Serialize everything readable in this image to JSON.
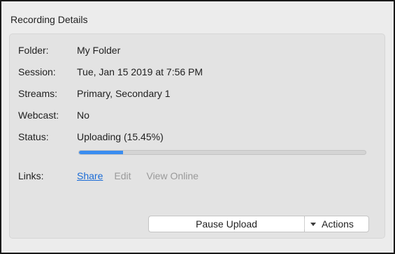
{
  "group": {
    "title": "Recording Details"
  },
  "details": {
    "folder": {
      "label": "Folder:",
      "value": "My Folder"
    },
    "session": {
      "label": "Session:",
      "value": "Tue, Jan 15 2019 at 7:56 PM"
    },
    "streams": {
      "label": "Streams:",
      "value": "Primary, Secondary 1"
    },
    "webcast": {
      "label": "Webcast:",
      "value": "No"
    },
    "status": {
      "label": "Status:",
      "value": "Uploading (15.45%)"
    }
  },
  "progress": {
    "percent": 15.45,
    "fill_color": "#3a8df0"
  },
  "links": {
    "label": "Links:",
    "share": "Share",
    "edit": "Edit",
    "view_online": "View Online"
  },
  "buttons": {
    "pause_upload": "Pause Upload",
    "actions": "Actions"
  },
  "icons": {
    "actions_menu": "chevron-down-icon"
  },
  "colors": {
    "link": "#1a6bd6",
    "disabled_link": "#9a9a9a"
  }
}
